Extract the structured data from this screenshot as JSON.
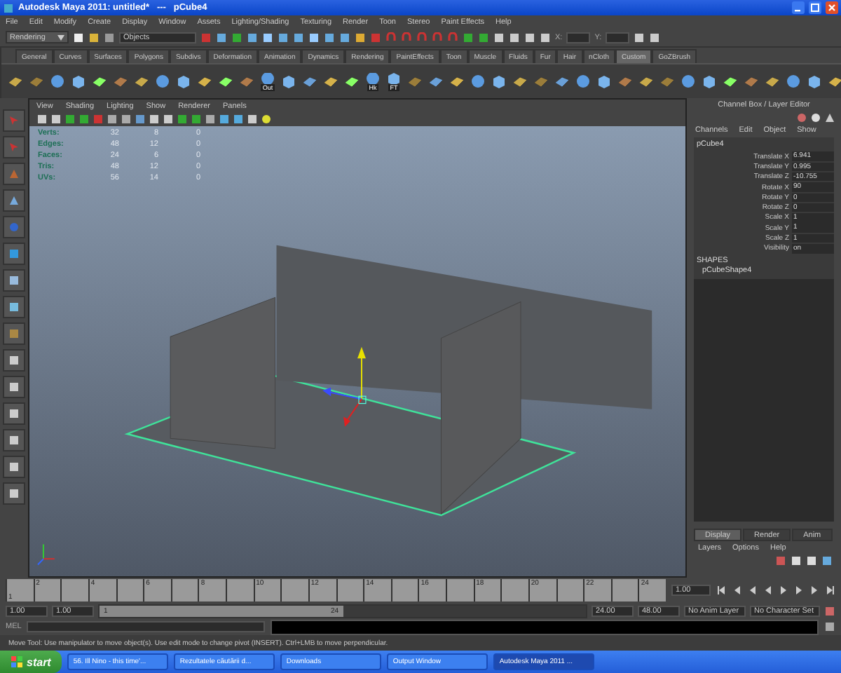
{
  "window": {
    "title": "Autodesk Maya 2011: untitled*   ---   pCube4"
  },
  "menu": [
    "File",
    "Edit",
    "Modify",
    "Create",
    "Display",
    "Window",
    "Assets",
    "Lighting/Shading",
    "Texturing",
    "Render",
    "Toon",
    "Stereo",
    "Paint Effects",
    "Help"
  ],
  "status_line": {
    "mode": "Rendering",
    "selection": "Objects",
    "x_label": "X:",
    "y_label": "Y:"
  },
  "shelf": {
    "tabs": [
      {
        "label": "General",
        "selected": false
      },
      {
        "label": "Curves",
        "selected": false
      },
      {
        "label": "Surfaces",
        "selected": false
      },
      {
        "label": "Polygons",
        "selected": false
      },
      {
        "label": "Subdivs",
        "selected": false
      },
      {
        "label": "Deformation",
        "selected": false
      },
      {
        "label": "Animation",
        "selected": false
      },
      {
        "label": "Dynamics",
        "selected": false
      },
      {
        "label": "Rendering",
        "selected": false
      },
      {
        "label": "PaintEffects",
        "selected": false
      },
      {
        "label": "Toon",
        "selected": false
      },
      {
        "label": "Muscle",
        "selected": false
      },
      {
        "label": "Fluids",
        "selected": false
      },
      {
        "label": "Fur",
        "selected": false
      },
      {
        "label": "Hair",
        "selected": false
      },
      {
        "label": "nCloth",
        "selected": false
      },
      {
        "label": "Custom",
        "selected": true
      },
      {
        "label": "GoZBrush",
        "selected": false
      }
    ],
    "icon_labels": [
      "Out",
      "Hk",
      "FT"
    ]
  },
  "viewport": {
    "menu": [
      "View",
      "Shading",
      "Lighting",
      "Show",
      "Renderer",
      "Panels"
    ],
    "hud": [
      {
        "label": "Verts:",
        "values": [
          "32",
          "8",
          "0"
        ]
      },
      {
        "label": "Edges:",
        "values": [
          "48",
          "12",
          "0"
        ]
      },
      {
        "label": "Faces:",
        "values": [
          "24",
          "6",
          "0"
        ]
      },
      {
        "label": "Tris:",
        "values": [
          "48",
          "12",
          "0"
        ]
      },
      {
        "label": "UVs:",
        "values": [
          "56",
          "14",
          "0"
        ]
      }
    ]
  },
  "channel_box": {
    "title": "Channel Box / Layer Editor",
    "menu": [
      "Channels",
      "Edit",
      "Object",
      "Show"
    ],
    "object": "pCube4",
    "channels": [
      {
        "name": "Translate X",
        "value": "6.941"
      },
      {
        "name": "Translate Y",
        "value": "0.995"
      },
      {
        "name": "Translate Z",
        "value": "-10.755"
      },
      {
        "name": "Rotate X",
        "value": "90"
      },
      {
        "name": "Rotate Y",
        "value": "0"
      },
      {
        "name": "Rotate Z",
        "value": "0"
      },
      {
        "name": "Scale X",
        "value": "1"
      },
      {
        "name": "Scale Y",
        "value": "1"
      },
      {
        "name": "Scale Z",
        "value": "1"
      },
      {
        "name": "Visibility",
        "value": "on"
      }
    ],
    "shapes_label": "SHAPES",
    "shape": "pCubeShape4"
  },
  "layer_editor": {
    "tabs": [
      {
        "label": "Display",
        "selected": true
      },
      {
        "label": "Render",
        "selected": false
      },
      {
        "label": "Anim",
        "selected": false
      }
    ],
    "menu": [
      "Layers",
      "Options",
      "Help"
    ]
  },
  "timeline": {
    "start": "1",
    "ticks": [
      "2",
      "4",
      "6",
      "8",
      "10",
      "12",
      "14",
      "16",
      "18",
      "20",
      "22",
      "24"
    ],
    "current": "1.00"
  },
  "range": {
    "level": 0.5,
    "start": "1.00",
    "range_start": "1.00",
    "slider_start": "1",
    "slider_end": "24",
    "range_end": "24.00",
    "end": "48.00",
    "anim_layer": "No Anim Layer",
    "character_set": "No Character Set"
  },
  "command_line": {
    "label": "MEL"
  },
  "help_line": "Move Tool: Use manipulator to move object(s). Use edit mode to change pivot (INSERT). Ctrl+LMB to move perpendicular.",
  "taskbar": {
    "start": "start",
    "items": [
      {
        "label": "56. Ill Nino - this time'...",
        "selected": false
      },
      {
        "label": "Rezultatele căutării d...",
        "selected": false
      },
      {
        "label": "Downloads",
        "selected": false
      },
      {
        "label": "Output Window",
        "selected": false
      },
      {
        "label": "Autodesk Maya 2011 ...",
        "selected": true
      }
    ]
  }
}
